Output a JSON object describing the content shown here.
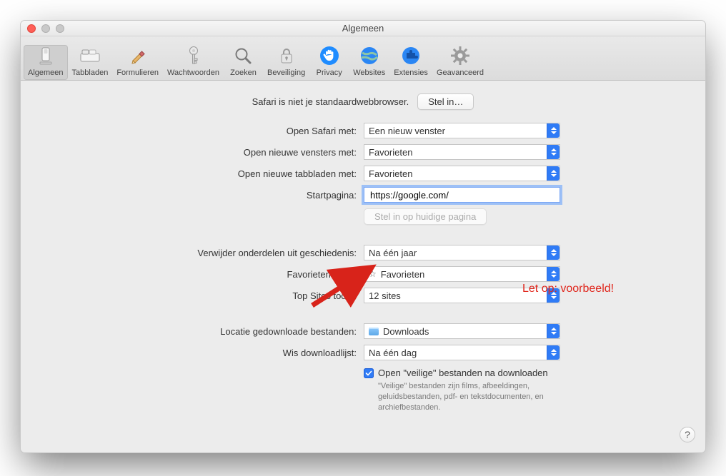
{
  "window": {
    "title": "Algemeen"
  },
  "toolbar": {
    "items": [
      {
        "label": "Algemeen"
      },
      {
        "label": "Tabbladen"
      },
      {
        "label": "Formulieren"
      },
      {
        "label": "Wachtwoorden"
      },
      {
        "label": "Zoeken"
      },
      {
        "label": "Beveiliging"
      },
      {
        "label": "Privacy"
      },
      {
        "label": "Websites"
      },
      {
        "label": "Extensies"
      },
      {
        "label": "Geavanceerd"
      }
    ]
  },
  "banner": {
    "message": "Safari is niet je standaardwebbrowser.",
    "button": "Stel in…"
  },
  "form": {
    "open_safari_label": "Open Safari met:",
    "open_safari_value": "Een nieuw venster",
    "new_windows_label": "Open nieuwe vensters met:",
    "new_windows_value": "Favorieten",
    "new_tabs_label": "Open nieuwe tabbladen met:",
    "new_tabs_value": "Favorieten",
    "homepage_label": "Startpagina:",
    "homepage_value": "https://google.com/",
    "set_current_button": "Stel in op huidige pagina",
    "history_label": "Verwijder onderdelen uit geschiedenis:",
    "history_value": "Na één jaar",
    "favorites_label": "Favorieten toont:",
    "favorites_value": "Favorieten",
    "topsites_label": "Top Sites toont:",
    "topsites_value": "12 sites",
    "download_loc_label": "Locatie gedownloade bestanden:",
    "download_loc_value": "Downloads",
    "clear_dl_label": "Wis downloadlijst:",
    "clear_dl_value": "Na één dag",
    "safe_open_checkbox": "Open \"veilige\" bestanden na downloaden",
    "safe_open_help": "\"Veilige\" bestanden zijn films, afbeeldingen, geluidsbestanden, pdf- en tekstdocumenten, en archiefbestanden."
  },
  "annotation": {
    "text": "Let op: voorbeeld!"
  },
  "help_button": "?"
}
